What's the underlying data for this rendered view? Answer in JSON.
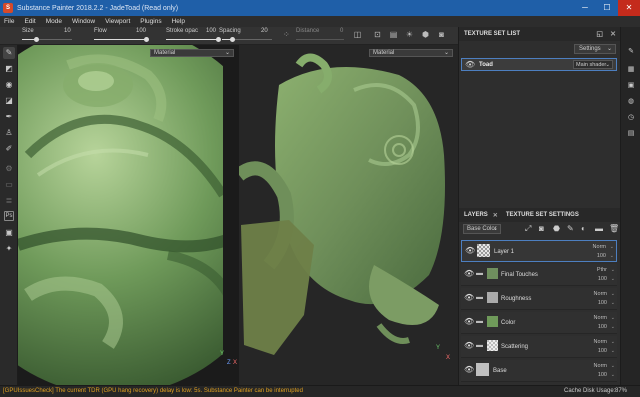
{
  "window": {
    "title": "Substance Painter 2018.2.2 - JadeToad (Read only)",
    "minimize": "─",
    "maximize": "☐",
    "close": "✕"
  },
  "menu": [
    "File",
    "Edit",
    "Mode",
    "Window",
    "Viewport",
    "Plugins",
    "Help"
  ],
  "toolbar": {
    "size_label": "Size",
    "size_value": "10",
    "size_fraction": 0.28,
    "flow_label": "Flow",
    "flow_value": "100",
    "flow_fraction": 1.0,
    "stroke_label": "Stroke opac",
    "stroke_value": "100",
    "stroke_fraction": 1.0,
    "spacing_label": "Spacing",
    "spacing_value": "20",
    "spacing_fraction": 0.2,
    "distance_label": "Distance",
    "distance_value": "0"
  },
  "viewport": {
    "material_left": "Material",
    "material_right": "Material",
    "axis_y": "Y",
    "axis_z": "Z",
    "axis_x": "X"
  },
  "texture_set_list": {
    "header": "TEXTURE SET LIST",
    "settings_label": "Settings",
    "item_name": "Toad",
    "item_shader": "Main shader"
  },
  "layers_panel": {
    "tab_layers": "LAYERS",
    "tab_settings": "TEXTURE SET SETTINGS",
    "channel": "Base Color",
    "layers": [
      {
        "name": "Layer 1",
        "blend": "Norm",
        "opacity": "100",
        "type": "fill",
        "color": "#c8c8c8"
      },
      {
        "name": "Final Touches",
        "blend": "Pthr",
        "opacity": "100",
        "type": "folder",
        "color": "#6f8f5e"
      },
      {
        "name": "Roughness",
        "blend": "Norm",
        "opacity": "100",
        "type": "folder",
        "color": "#aaaaaa"
      },
      {
        "name": "Color",
        "blend": "Norm",
        "opacity": "100",
        "type": "folder",
        "color": "#6f9a5a"
      },
      {
        "name": "Scattering",
        "blend": "Norm",
        "opacity": "100",
        "type": "folder",
        "color": "#dddddd"
      },
      {
        "name": "Base",
        "blend": "Norm",
        "opacity": "100",
        "type": "fill",
        "color": "#bfbfbf"
      }
    ]
  },
  "status": {
    "message": "[GPUIssuesCheck] The current TDR (GPU hang recovery) delay is low: 5s. Substance Painter can be interrupted",
    "cache_label": "Cache Disk Usage:",
    "cache_value": "87%"
  },
  "colors": {
    "accent": "#1f5fa8",
    "jade": "#6f9a5a",
    "warning": "#e0a020"
  }
}
